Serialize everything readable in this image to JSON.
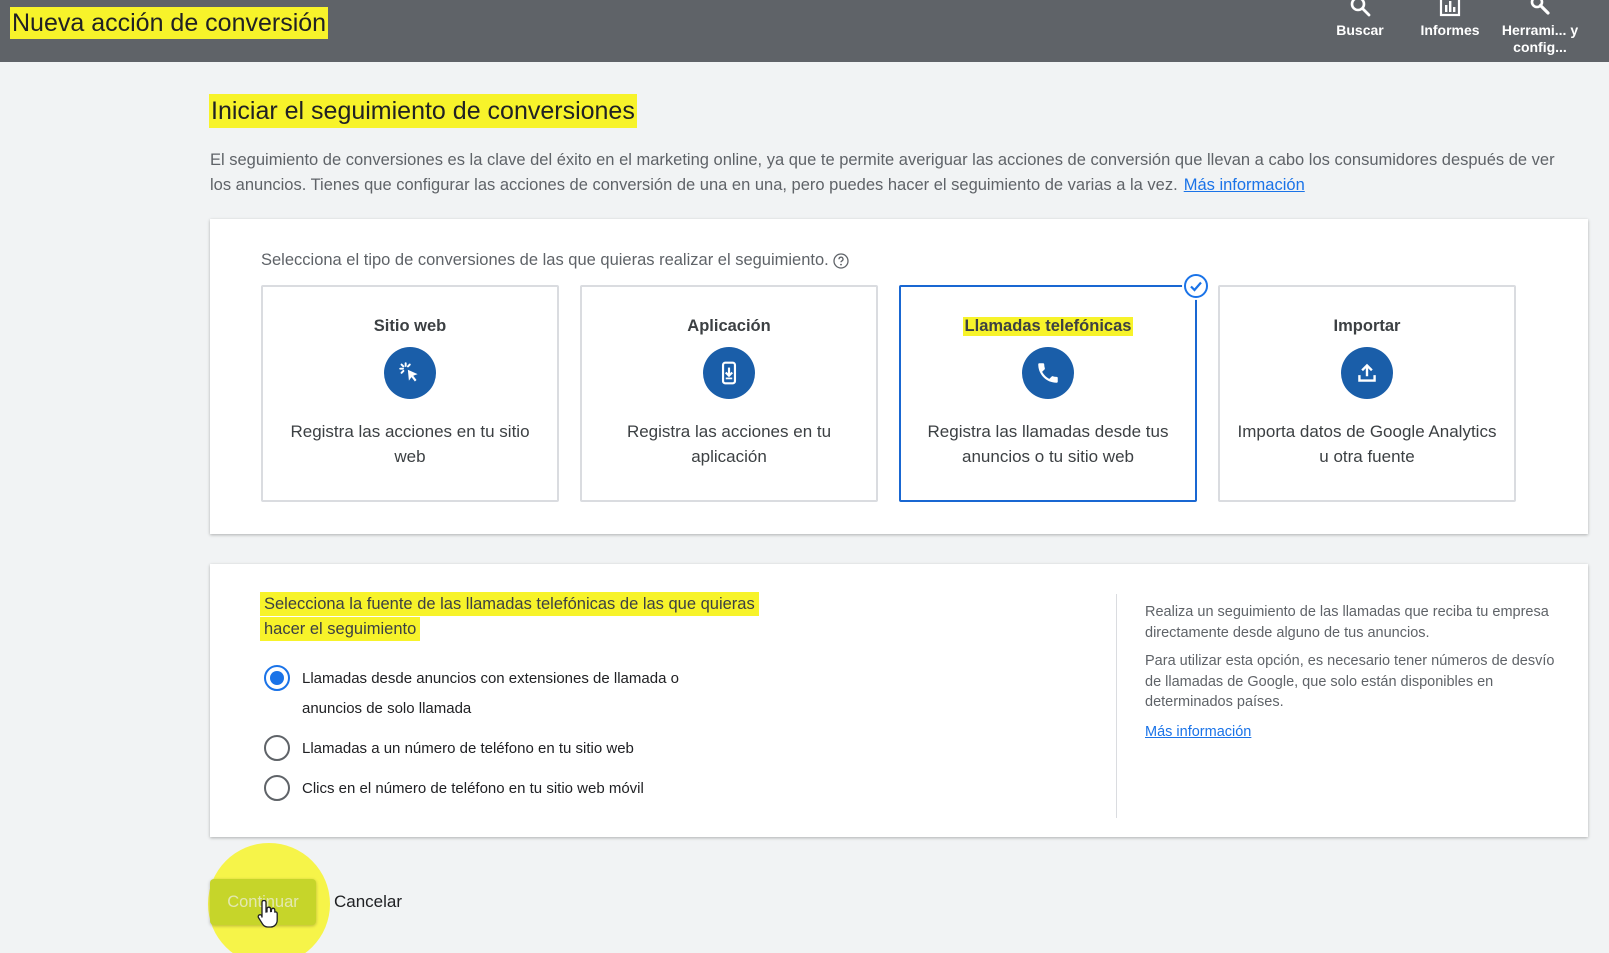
{
  "header": {
    "title": "Nueva acción de conversión",
    "actions": [
      {
        "label": "Buscar",
        "icon": "search-icon"
      },
      {
        "label": "Informes",
        "icon": "bar-chart-icon"
      },
      {
        "label": "Herrami... y config...",
        "icon": "wrench-icon"
      }
    ]
  },
  "main": {
    "title": "Iniciar el seguimiento de conversiones",
    "intro": "El seguimiento de conversiones es la clave del éxito en el marketing online, ya que te permite averiguar las acciones de conversión que llevan a cabo los consumidores después de ver los anuncios. Tienes que configurar las acciones de conversión de una en una, pero puedes hacer el seguimiento de varias a la vez.",
    "intro_link": "Más información"
  },
  "type_selector": {
    "prompt": "Selecciona el tipo de conversiones de las que quieras realizar el seguimiento.",
    "cards": [
      {
        "title": "Sitio web",
        "description": "Registra las acciones en tu sitio web",
        "icon": "click-cursor-icon",
        "selected": false
      },
      {
        "title": "Aplicación",
        "description": "Registra las acciones en tu aplicación",
        "icon": "phone-download-icon",
        "selected": false
      },
      {
        "title": "Llamadas telefónicas",
        "description": "Registra las llamadas desde tus anuncios o tu sitio web",
        "icon": "phone-call-icon",
        "selected": true
      },
      {
        "title": "Importar",
        "description": "Importa datos de Google Analytics u otra fuente",
        "icon": "upload-icon",
        "selected": false
      }
    ]
  },
  "call_source": {
    "prompt": "Selecciona la fuente de las llamadas telefónicas de las que quieras hacer el seguimiento",
    "options": [
      {
        "label": "Llamadas desde anuncios con extensiones de llamada o anuncios de solo llamada",
        "checked": true
      },
      {
        "label": "Llamadas a un número de teléfono en tu sitio web",
        "checked": false
      },
      {
        "label": "Clics en el número de teléfono en tu sitio web móvil",
        "checked": false
      }
    ],
    "info": [
      "Realiza un seguimiento de las llamadas que reciba tu empresa directamente desde alguno de tus anuncios.",
      "Para utilizar esta opción, es necesario tener números de desvío de llamadas de Google, que solo están disponibles en determinados países."
    ],
    "info_link": "Más información"
  },
  "buttons": {
    "continue_label": "Continuar",
    "cancel_label": "Cancelar"
  },
  "colors": {
    "topbar": "#5f6368",
    "accent": "#1a73e8",
    "icon_circle": "#1a5ea9",
    "highlight": "#f7f32a"
  }
}
